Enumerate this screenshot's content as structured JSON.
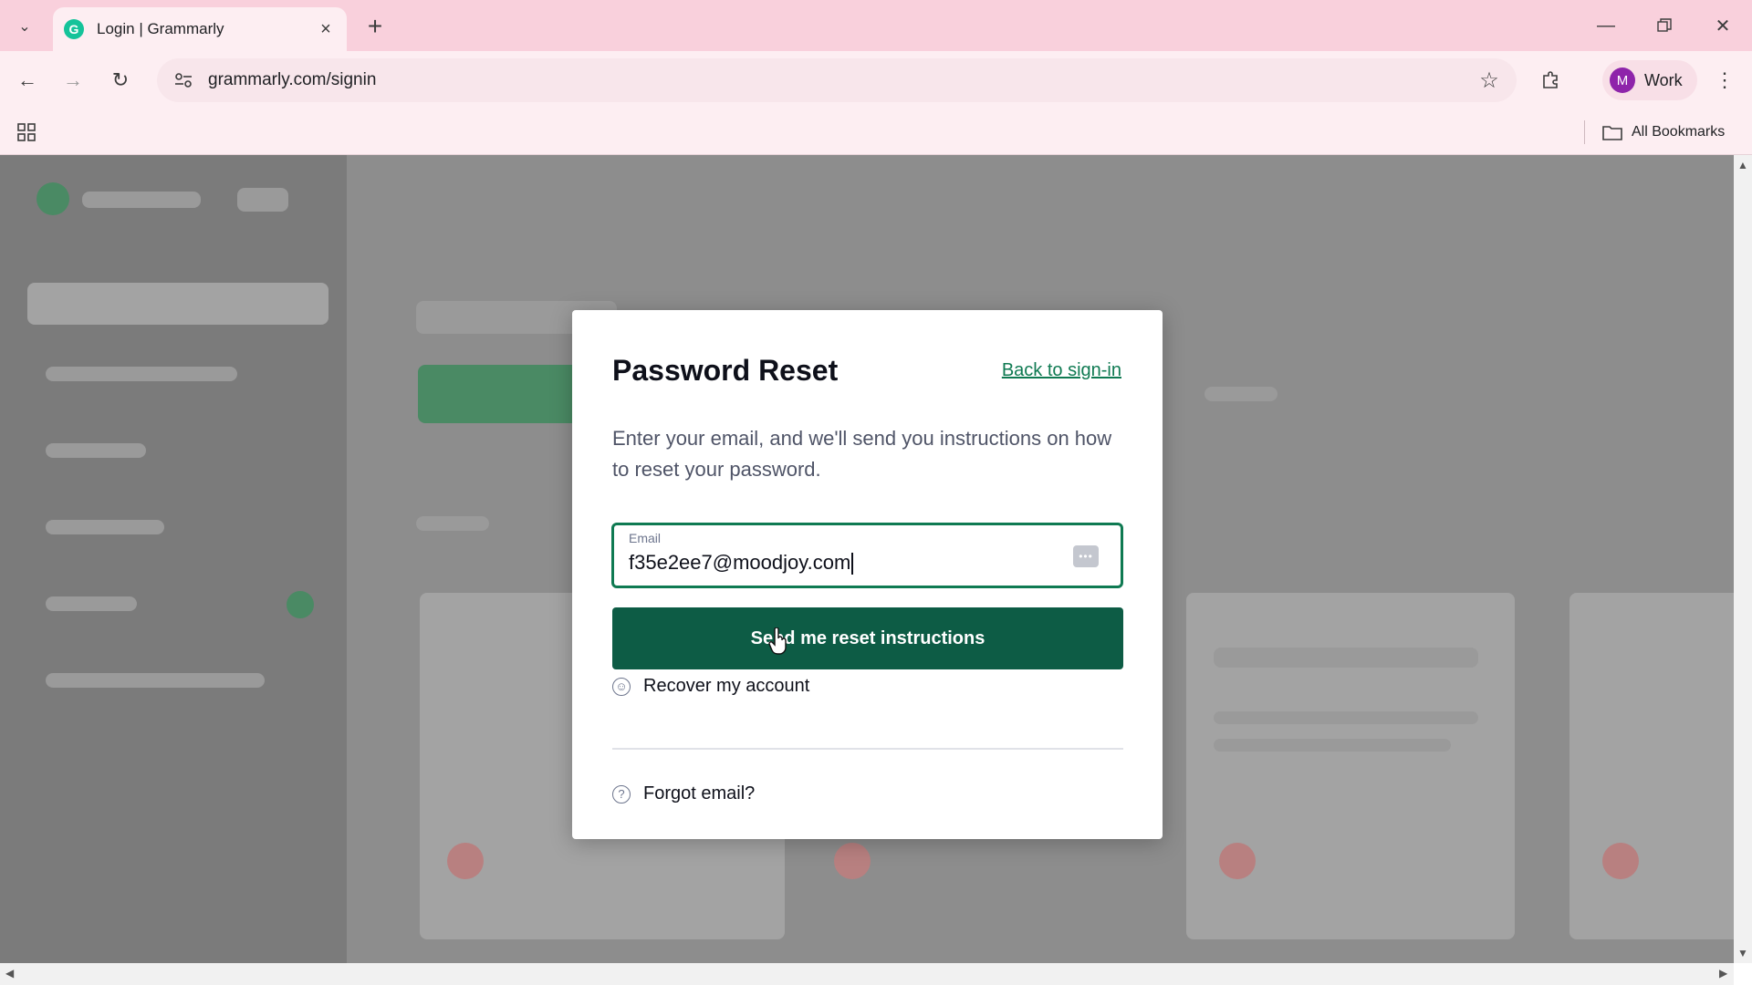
{
  "browser": {
    "tab": {
      "title": "Login | Grammarly",
      "favicon": "grammarly-g-icon"
    },
    "url": "grammarly.com/signin",
    "profile": {
      "initial": "M",
      "name": "Work",
      "color": "#8e24aa"
    },
    "bookmarks": {
      "all_label": "All Bookmarks"
    },
    "theme": {
      "tabstrip": "#f9d0dc",
      "toolbar": "#fdeef2"
    }
  },
  "modal": {
    "title": "Password Reset",
    "back_link": "Back to sign-in",
    "description": "Enter your email, and we'll send you instructions on how to reset your password.",
    "email": {
      "label": "Email",
      "value": "f35e2ee7@moodjoy.com"
    },
    "send_button": "Send me reset instructions",
    "options": [
      {
        "label": "Recover my account",
        "icon": "smiley-icon"
      },
      {
        "label": "Forgot email?",
        "icon": "question-circle-icon"
      }
    ],
    "colors": {
      "accent": "#0f7a52",
      "button": "#0d5c45"
    }
  }
}
